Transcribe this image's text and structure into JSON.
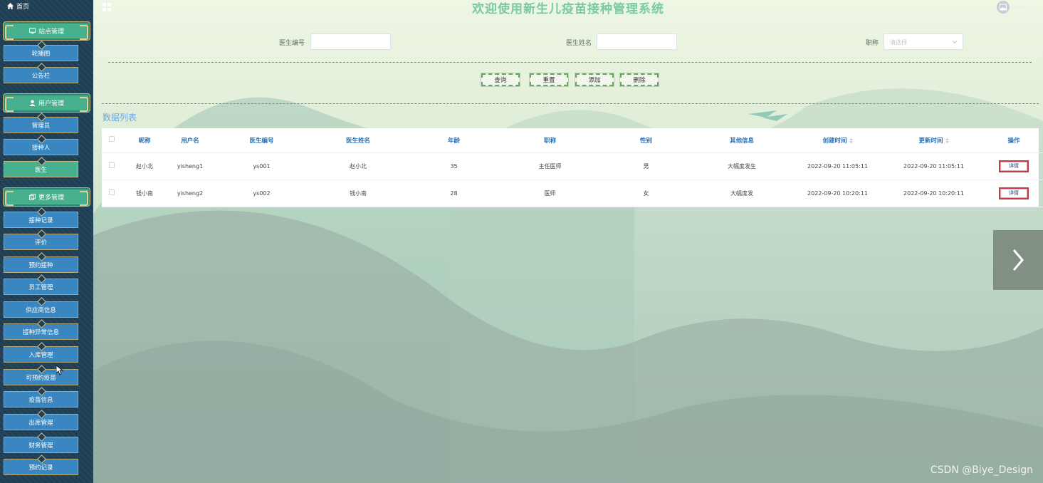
{
  "header": {
    "home_label": "首页",
    "title": "欢迎使用新生儿疫苗接种管理系统",
    "user_name": "admin"
  },
  "sidebar": {
    "groups": [
      {
        "label": "站点管理",
        "icon": "monitor-icon"
      },
      {
        "label": "用户管理",
        "icon": "user-icon"
      },
      {
        "label": "更多管理",
        "icon": "copy-icon"
      }
    ],
    "items": [
      {
        "label": "轮播图"
      },
      {
        "label": "公告栏"
      },
      {
        "label": "管理员"
      },
      {
        "label": "接种人"
      },
      {
        "label": "医生",
        "active": true
      },
      {
        "label": "接种记录"
      },
      {
        "label": "评价"
      },
      {
        "label": "预约接种"
      },
      {
        "label": "员工管理"
      },
      {
        "label": "供应商信息"
      },
      {
        "label": "接种异常信息"
      },
      {
        "label": "入库管理"
      },
      {
        "label": "可预约疫苗"
      },
      {
        "label": "疫苗信息"
      },
      {
        "label": "出库管理"
      },
      {
        "label": "财务管理"
      },
      {
        "label": "预约记录"
      }
    ]
  },
  "search": {
    "doctor_no_label": "医生编号",
    "doctor_no_value": "",
    "doctor_name_label": "医生姓名",
    "doctor_name_value": "",
    "title_label": "职称",
    "title_placeholder": "请选择"
  },
  "actions": {
    "query": "查询",
    "reset": "重置",
    "add": "添加",
    "delete": "删除"
  },
  "list": {
    "title": "数据列表",
    "columns": [
      "昵称",
      "用户名",
      "医生编号",
      "医生姓名",
      "年龄",
      "职称",
      "性别",
      "其他信息",
      "创建时间",
      "更新时间",
      "操作"
    ],
    "rows": [
      {
        "nickname": "赵小北",
        "username": "yisheng1",
        "doctor_no": "ys001",
        "doctor_name": "赵小北",
        "age": "35",
        "title": "主任医师",
        "gender": "男",
        "other": "大幅度发生",
        "created": "2022-09-20 11:05:11",
        "updated": "2022-09-20 11:05:11",
        "action": "详情"
      },
      {
        "nickname": "钱小南",
        "username": "yisheng2",
        "doctor_no": "ys002",
        "doctor_name": "钱小南",
        "age": "28",
        "title": "医师",
        "gender": "女",
        "other": "大幅度发",
        "created": "2022-09-20 10:20:11",
        "updated": "2022-09-20 10:20:11",
        "action": "详情"
      }
    ]
  },
  "watermark": "CSDN @Biye_Design",
  "colors": {
    "sidebar_bg": "#1f3f55",
    "menu_item": "#3a86c0",
    "menu_active": "#46b08f",
    "title": "#7bc9a4",
    "header_text": "#2a73b8",
    "detail_border": "#c33a4a"
  }
}
